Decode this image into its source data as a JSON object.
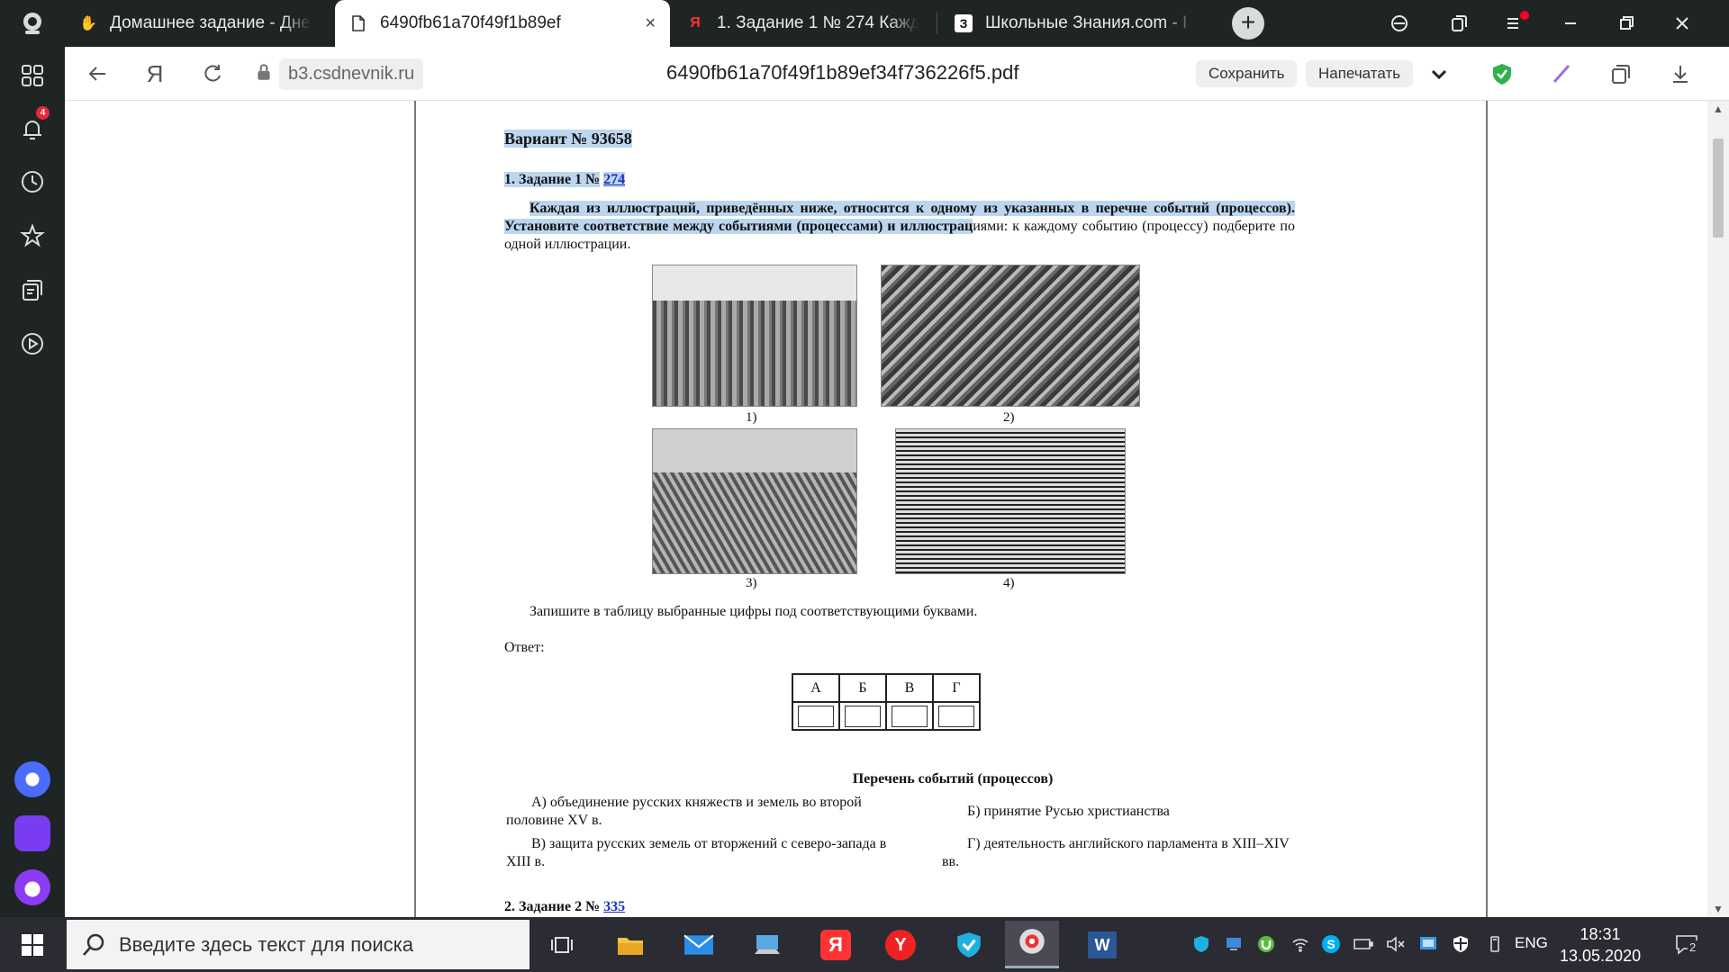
{
  "tabs": [
    {
      "title": "Домашнее задание - Дне",
      "icon": "dnevnik-hand-icon",
      "active": false
    },
    {
      "title": "6490fb61a70f49f1b89ef",
      "icon": "document-icon",
      "active": true,
      "close": "×"
    },
    {
      "title": "1. Задание 1 № 274 Кажд",
      "icon": "yandex-icon",
      "active": false
    },
    {
      "title": "Школьные Знания.com - I",
      "icon": "znania-icon",
      "active": false
    }
  ],
  "sidebar": {
    "notification_count": "4"
  },
  "toolbar": {
    "url": "b3.csdnevnik.ru",
    "doc_title": "6490fb61a70f49f1b89ef34f736226f5.pdf",
    "save_label": "Сохранить",
    "print_label": "Напечатать"
  },
  "document": {
    "variant_title": "Вариант № 93658",
    "task1_heading": "1. Задание 1 №",
    "task1_number": "274",
    "task1_text_hl": "Каждая из иллюстраций, приведённых ниже, относится к одному из указанных в перечне событий (процессов). Установите соответствие между событиями (процессами) и иллюстрац",
    "task1_text_rest": "иями: к каждому событию (процессу) подберите по одной иллюстрации.",
    "captions": [
      "1)",
      "2)",
      "3)",
      "4)"
    ],
    "instruction": "Запишите в таблицу выбранные цифры под соответствующими буквами.",
    "answer_label": "Ответ:",
    "answer_headers": [
      "А",
      "Б",
      "В",
      "Г"
    ],
    "events_title": "Перечень событий (процессов)",
    "events": [
      "А) объединение русских княжеств и земель во второй половине XV в.",
      "Б) принятие Русью христианства",
      "В) защита русских земель от вторжений с северо-запада в XIII в.",
      "Г) деятельность английского парламента в XIII–XIV вв."
    ],
    "task2_heading": "2. Задание 2 №",
    "task2_number": "335"
  },
  "taskbar": {
    "search_placeholder": "Введите здесь текст для поиска",
    "lang": "ENG",
    "time": "18:31",
    "date": "13.05.2020",
    "notifications_count": "2"
  },
  "colors": {
    "sidebar_bg": "#1f2424",
    "taskbar_bg": "#2b2b33",
    "selection": "#bcd6ef",
    "link": "#1a2fc0"
  }
}
